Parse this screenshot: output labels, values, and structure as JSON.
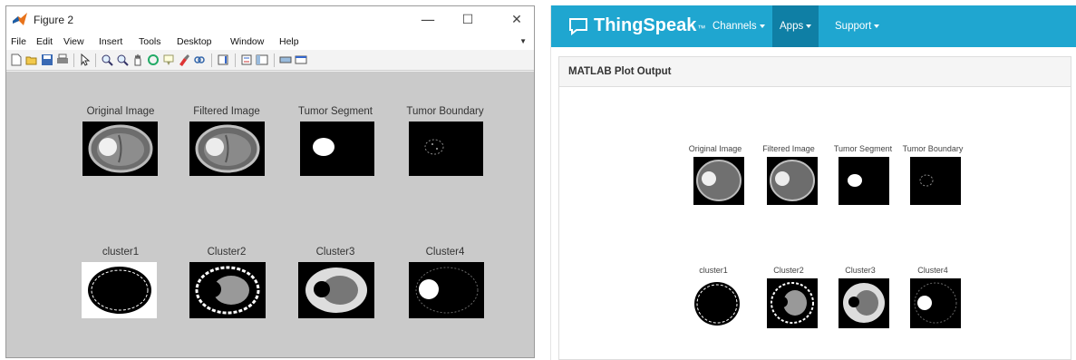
{
  "matlab": {
    "window_title": "Figure 2",
    "controls": {
      "minimize": "—",
      "maximize": "☐",
      "close": "✕"
    },
    "menu": [
      "File",
      "Edit",
      "View",
      "Insert",
      "Tools",
      "Desktop",
      "Window",
      "Help"
    ],
    "toolbar_icons": [
      "new-figure-icon",
      "open-file-icon",
      "save-icon",
      "print-icon",
      "pointer-icon",
      "zoom-in-icon",
      "zoom-out-icon",
      "pan-icon",
      "rotate-icon",
      "data-cursor-icon",
      "brush-icon",
      "link-icon",
      "insert-colorbar-icon",
      "insert-legend-icon",
      "hide-plot-tools-icon",
      "show-plot-tools-icon"
    ],
    "subplot_titles": {
      "row1": [
        "Original Image",
        "Filtered Image",
        "Tumor Segment",
        "Tumor Boundary"
      ],
      "row2": [
        "cluster1",
        "Cluster2",
        "Cluster3",
        "Cluster4"
      ]
    }
  },
  "thingspeak": {
    "brand": "ThingSpeak",
    "trademark": "™",
    "nav": [
      "Channels",
      "Apps",
      "Support"
    ],
    "active_nav": "Apps",
    "panel_title": "MATLAB Plot Output",
    "subplot_titles": {
      "row1": [
        "Original Image",
        "Filtered Image",
        "Tumor Segment",
        "Tumor Boundary"
      ],
      "row2": [
        "cluster1",
        "Cluster2",
        "Cluster3",
        "Cluster4"
      ]
    },
    "colors": {
      "navbar": "#1fa6d0",
      "active_nav": "#0f7fa5"
    }
  }
}
